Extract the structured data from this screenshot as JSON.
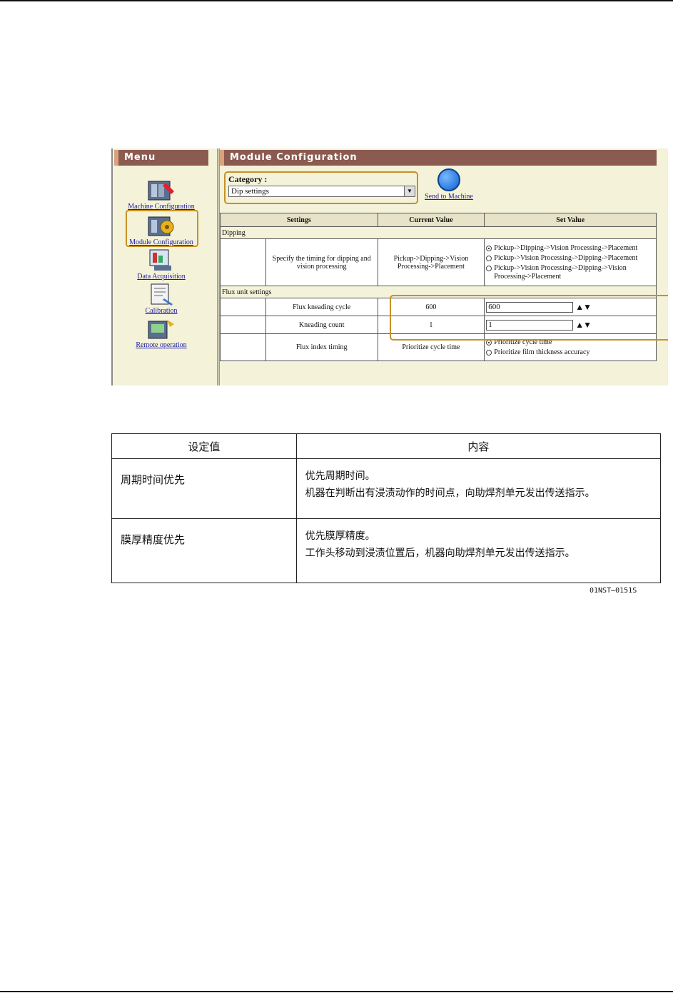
{
  "screen": {
    "menu": {
      "title": "Menu",
      "items": [
        {
          "label": "Machine Configuration",
          "icon": "machine-config-icon"
        },
        {
          "label": "Module Configuration",
          "icon": "module-config-icon"
        },
        {
          "label": "Data Acquisition",
          "icon": "data-acquisition-icon"
        },
        {
          "label": "Calibration",
          "icon": "calibration-icon"
        },
        {
          "label": "Remote operation",
          "icon": "remote-operation-icon"
        }
      ]
    },
    "main": {
      "title": "Module Configuration",
      "category_label": "Category :",
      "category_value": "Dip settings",
      "send_label": "Send to Machine",
      "headers": {
        "settings": "Settings",
        "current": "Current Value",
        "set": "Set Value"
      },
      "section_dipping": "Dipping",
      "dipping_row": {
        "setting": "Specify the timing for dipping and vision processing",
        "current": "Pickup->Dipping->Vision Processing->Placement",
        "options": [
          "Pickup->Dipping->Vision Processing->Placement",
          "Pickup->Vision Processing->Dipping->Placement",
          "Pickup->Vision Processing->Dipping->Vision Processing->Placement"
        ],
        "selected_index": 0
      },
      "section_flux": "Flux unit settings",
      "flux_kneading": {
        "setting": "Flux kneading cycle",
        "current": "600",
        "value": "600"
      },
      "kneading_count": {
        "setting": "Kneading count",
        "current": "1",
        "value": "1"
      },
      "spin_arrows": "▲▼",
      "flux_index": {
        "setting": "Flux index timing",
        "current": "Prioritize cycle time",
        "options": [
          "Prioritize cycle time",
          "Prioritize film thickness accuracy"
        ],
        "selected_index": 0
      }
    }
  },
  "table": {
    "header_set": "设定值",
    "header_content": "内容",
    "rows": [
      {
        "set": "周期时间优先",
        "line1": "优先周期时间。",
        "line2": "机器在判断出有浸渍动作的时间点，向助焊剂单元发出传送指示。"
      },
      {
        "set": "膜厚精度优先",
        "line1": "优先膜厚精度。",
        "line2": "工作头移动到浸渍位置后，机器向助焊剂单元发出传送指示。"
      }
    ]
  },
  "figure_code": "01NST–0151S"
}
